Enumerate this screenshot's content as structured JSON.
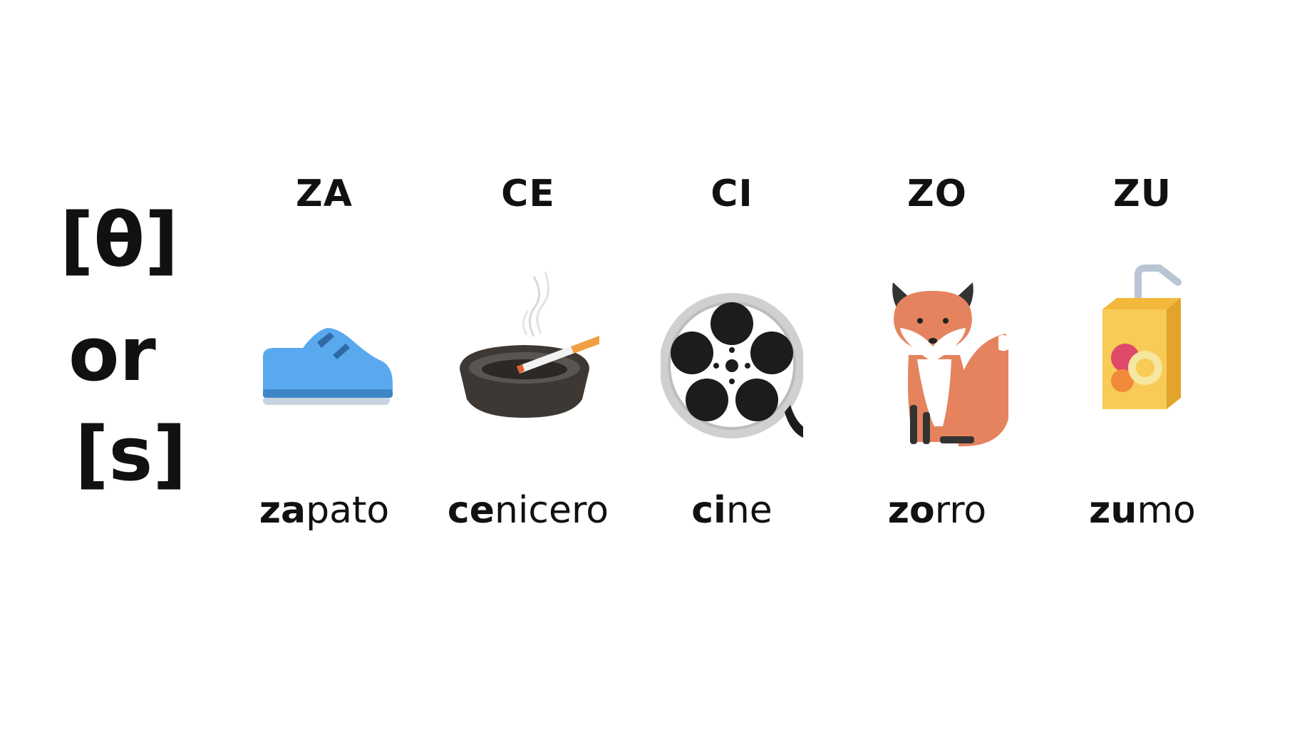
{
  "phonemes": {
    "theta": "[θ]",
    "or": "or",
    "s": "[s]"
  },
  "columns": [
    {
      "syllable": "ZA",
      "word_highlight": "za",
      "word_rest": "pato",
      "icon": "shoe-icon"
    },
    {
      "syllable": "CE",
      "word_highlight": "ce",
      "word_rest": "nicero",
      "icon": "ashtray-icon"
    },
    {
      "syllable": "CI",
      "word_highlight": "ci",
      "word_rest": "ne",
      "icon": "film-reel-icon"
    },
    {
      "syllable": "ZO",
      "word_highlight": "zo",
      "word_rest": "rro",
      "icon": "fox-icon"
    },
    {
      "syllable": "ZU",
      "word_highlight": "zu",
      "word_rest": "mo",
      "icon": "juice-box-icon"
    }
  ],
  "colors": {
    "text": "#111111",
    "shoe": "#5aa9ee",
    "ashtray": "#4a4540",
    "reel": "#cfcfcf",
    "fox": "#e5835f",
    "juice": "#f7cb55"
  }
}
